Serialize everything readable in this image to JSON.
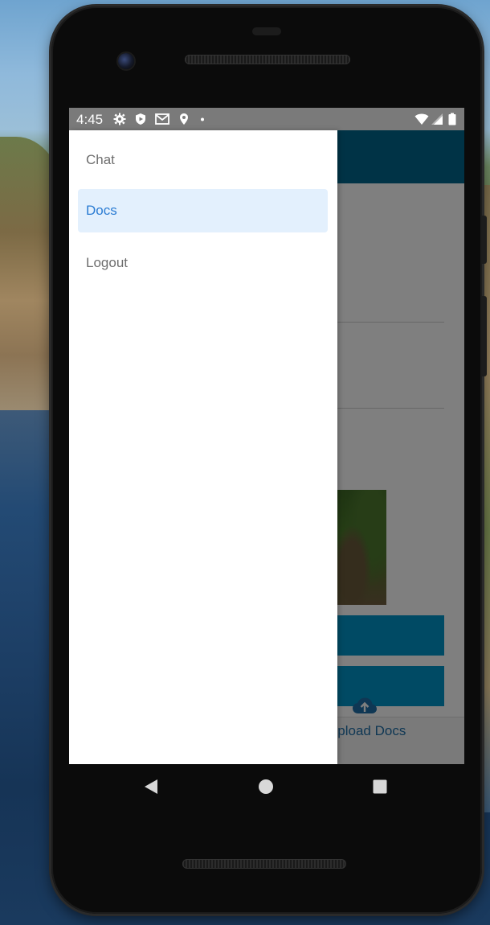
{
  "status_bar": {
    "time": "4:45",
    "icons_left": [
      "settings-icon",
      "shield-play-icon",
      "gmail-icon",
      "location-icon",
      "dot-icon"
    ],
    "icons_right": [
      "wifi-icon",
      "cellular-icon",
      "battery-icon"
    ]
  },
  "drawer": {
    "items": [
      {
        "label": "Chat",
        "active": false
      },
      {
        "label": "Docs",
        "active": true
      },
      {
        "label": "Logout",
        "active": false
      }
    ],
    "active_color": "#2b7cd3",
    "active_bg": "#e3f0fd"
  },
  "background_app": {
    "topbar_color": "#00668c",
    "button_color": "#0095c8",
    "bottom_nav": {
      "upload_label": "Upload Docs",
      "upload_icon": "cloud-upload-icon"
    }
  },
  "system_nav": {
    "buttons": [
      "back-icon",
      "home-icon",
      "recents-icon"
    ]
  }
}
